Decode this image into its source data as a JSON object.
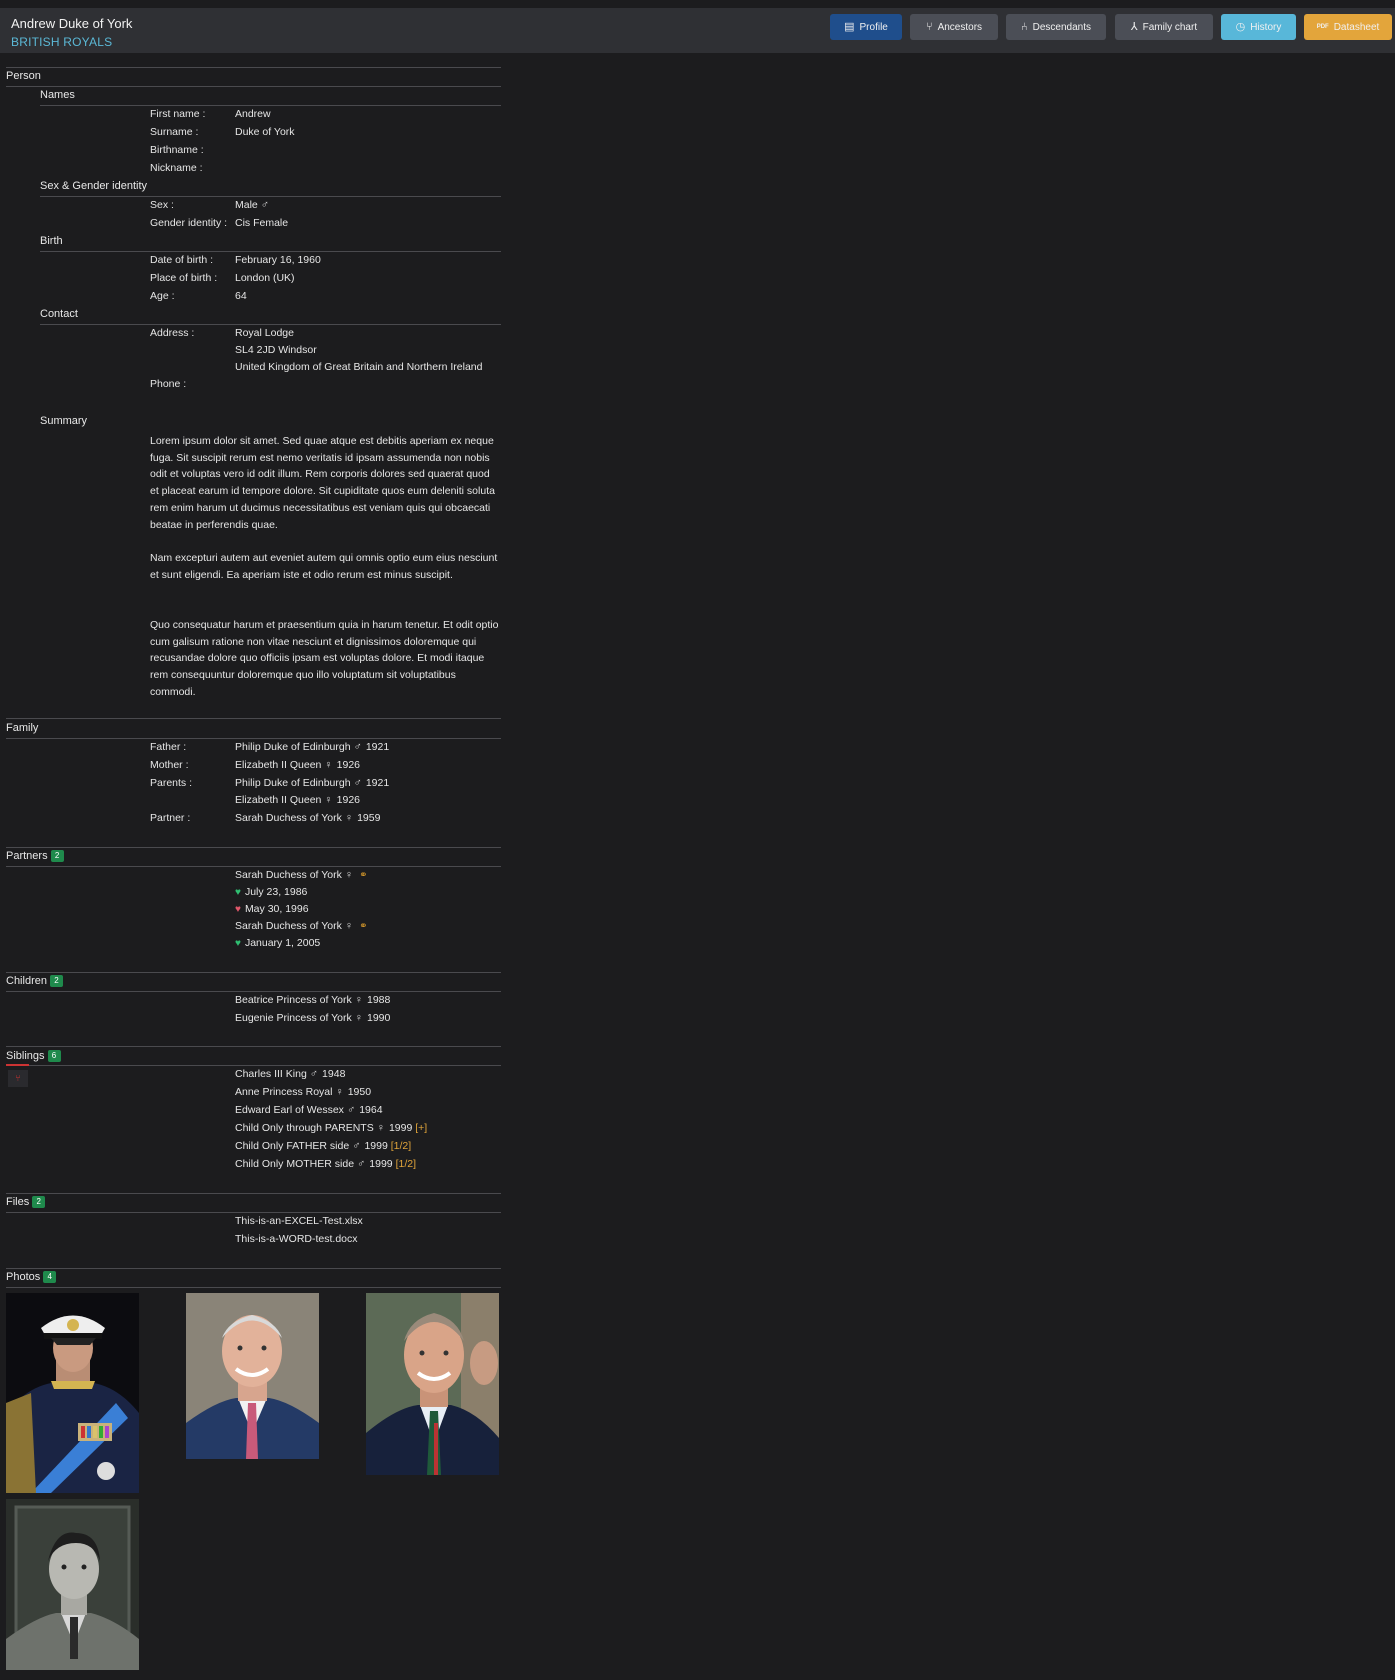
{
  "header": {
    "title": "Andrew Duke of York",
    "subtitle": "BRITISH ROYALS",
    "buttons": {
      "profile": "Profile",
      "ancestors": "Ancestors",
      "descendants": "Descendants",
      "family_chart": "Family chart",
      "history": "History",
      "datasheet": "Datasheet",
      "datasheet_icon": "PDF"
    }
  },
  "person": {
    "title": "Person",
    "names": {
      "title": "Names",
      "first_name_label": "First name :",
      "first_name": "Andrew",
      "surname_label": "Surname :",
      "surname": "Duke of York",
      "birthname_label": "Birthname :",
      "nickname_label": "Nickname :"
    },
    "sex": {
      "title": "Sex & Gender identity",
      "sex_label": "Sex :",
      "sex": "Male",
      "gender_label": "Gender identity :",
      "gender": "Cis Female"
    },
    "birth": {
      "title": "Birth",
      "date_label": "Date of birth :",
      "date": "February 16, 1960",
      "place_label": "Place of birth :",
      "place": "London (UK)",
      "age_label": "Age :",
      "age": "64"
    },
    "contact": {
      "title": "Contact",
      "address_label": "Address :",
      "address_line1": "Royal Lodge",
      "address_line2": "SL4 2JD Windsor",
      "address_line3": "United Kingdom of Great Britain and Northern Ireland",
      "phone_label": "Phone :"
    },
    "summary": {
      "title": "Summary",
      "p1": "Lorem ipsum dolor sit amet. Sed quae atque est debitis aperiam ex neque fuga. Sit suscipit rerum est nemo veritatis id ipsam assumenda non nobis odit et voluptas vero id odit illum. Rem corporis dolores sed quaerat quod et placeat earum id tempore dolore. Sit cupiditate quos eum deleniti soluta rem enim harum ut ducimus necessitatibus est veniam quis qui obcaecati beatae in perferendis quae.",
      "p2": "Nam excepturi autem aut eveniet autem qui omnis optio eum eius nesciunt et sunt eligendi. Ea aperiam iste et odio rerum est minus suscipit.",
      "p3": "Quo consequatur harum et praesentium quia in harum tenetur. Et odit optio cum galisum ratione non vitae nesciunt et dignissimos doloremque qui recusandae dolore quo officiis ipsam est voluptas dolore. Et modi itaque rem consequuntur doloremque quo illo voluptatum sit voluptatibus commodi."
    }
  },
  "family": {
    "title": "Family",
    "father_label": "Father :",
    "father": "Philip Duke of Edinburgh",
    "father_year": "1921",
    "mother_label": "Mother :",
    "mother": "Elizabeth II Queen",
    "mother_year": "1926",
    "parents_label": "Parents :",
    "parent1": "Philip Duke of Edinburgh",
    "parent1_year": "1921",
    "parent2": "Elizabeth II Queen",
    "parent2_year": "1926",
    "partner_label": "Partner :",
    "partner": "Sarah Duchess of York",
    "partner_year": "1959"
  },
  "partners": {
    "title": "Partners",
    "count": "2",
    "p1_name": "Sarah Duchess of York",
    "p1_date1": "July 23, 1986",
    "p1_date2": "May 30, 1996",
    "p2_name": "Sarah Duchess of York",
    "p2_date1": "January 1, 2005"
  },
  "children": {
    "title": "Children",
    "count": "2",
    "c1": "Beatrice Princess of York",
    "c1_year": "1988",
    "c2": "Eugenie Princess of York",
    "c2_year": "1990"
  },
  "siblings": {
    "title": "Siblings",
    "count": "6",
    "s1": "Charles III King",
    "s1_year": "1948",
    "s2": "Anne Princess Royal",
    "s2_year": "1950",
    "s3": "Edward Earl of Wessex",
    "s3_year": "1964",
    "s4": "Child Only through PARENTS",
    "s4_year": "1999",
    "s4_tag": "[+]",
    "s5": "Child Only FATHER side",
    "s5_year": "1999",
    "s5_tag": "[1/2]",
    "s6": "Child Only MOTHER side",
    "s6_year": "1999",
    "s6_tag": "[1/2]"
  },
  "files": {
    "title": "Files",
    "count": "2",
    "f1": "This-is-an-EXCEL-Test.xlsx",
    "f2": "This-is-a-WORD-test.docx"
  },
  "photos": {
    "title": "Photos",
    "count": "4"
  },
  "colors": {
    "background": "#1c1c1e",
    "header": "#2f3034",
    "subtitle": "#5bb8d6",
    "profile_btn": "#1f4e8c",
    "history_btn": "#58b7d9",
    "datasheet_btn": "#e3a53b",
    "badge": "#1f8a4c"
  },
  "icons": {
    "male": "male-symbol-icon",
    "female": "female-symbol-icon",
    "marriage": "rings-icon",
    "start": "green-heart-icon",
    "end": "broken-heart-icon"
  }
}
